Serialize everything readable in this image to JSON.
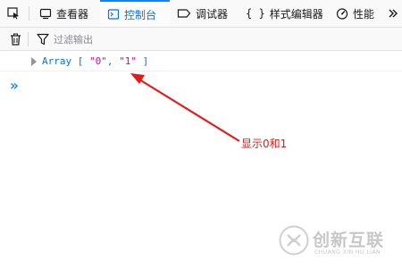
{
  "tabs": [
    {
      "label": "",
      "icon": "element-picker-icon"
    },
    {
      "label": "查看器",
      "icon": "inspector-icon"
    },
    {
      "label": "控制台",
      "icon": "console-icon",
      "active": true
    },
    {
      "label": "调试器",
      "icon": "debugger-icon"
    },
    {
      "label": "样式编辑器",
      "icon": "style-editor-icon"
    },
    {
      "label": "性能",
      "icon": "performance-icon"
    }
  ],
  "toolbar": {
    "trash_icon": "trash-icon",
    "filter_icon": "filter-icon",
    "filter_placeholder": "过滤输出"
  },
  "console": {
    "log_keyword": "Array",
    "log_open": " [ ",
    "item0": "\"0\"",
    "comma": ", ",
    "item1": "\"1\"",
    "log_close": " ]",
    "prompt_glyph": "»"
  },
  "annotation": {
    "text": "显示0和1",
    "color": "#e21b1b"
  },
  "watermark": {
    "text": "创新互联",
    "sub": "CHUANG XIN HU LIAN"
  },
  "colors": {
    "accent": "#0a84ff",
    "tab_active_text": "#0074e8",
    "string": "#dd00a9"
  }
}
